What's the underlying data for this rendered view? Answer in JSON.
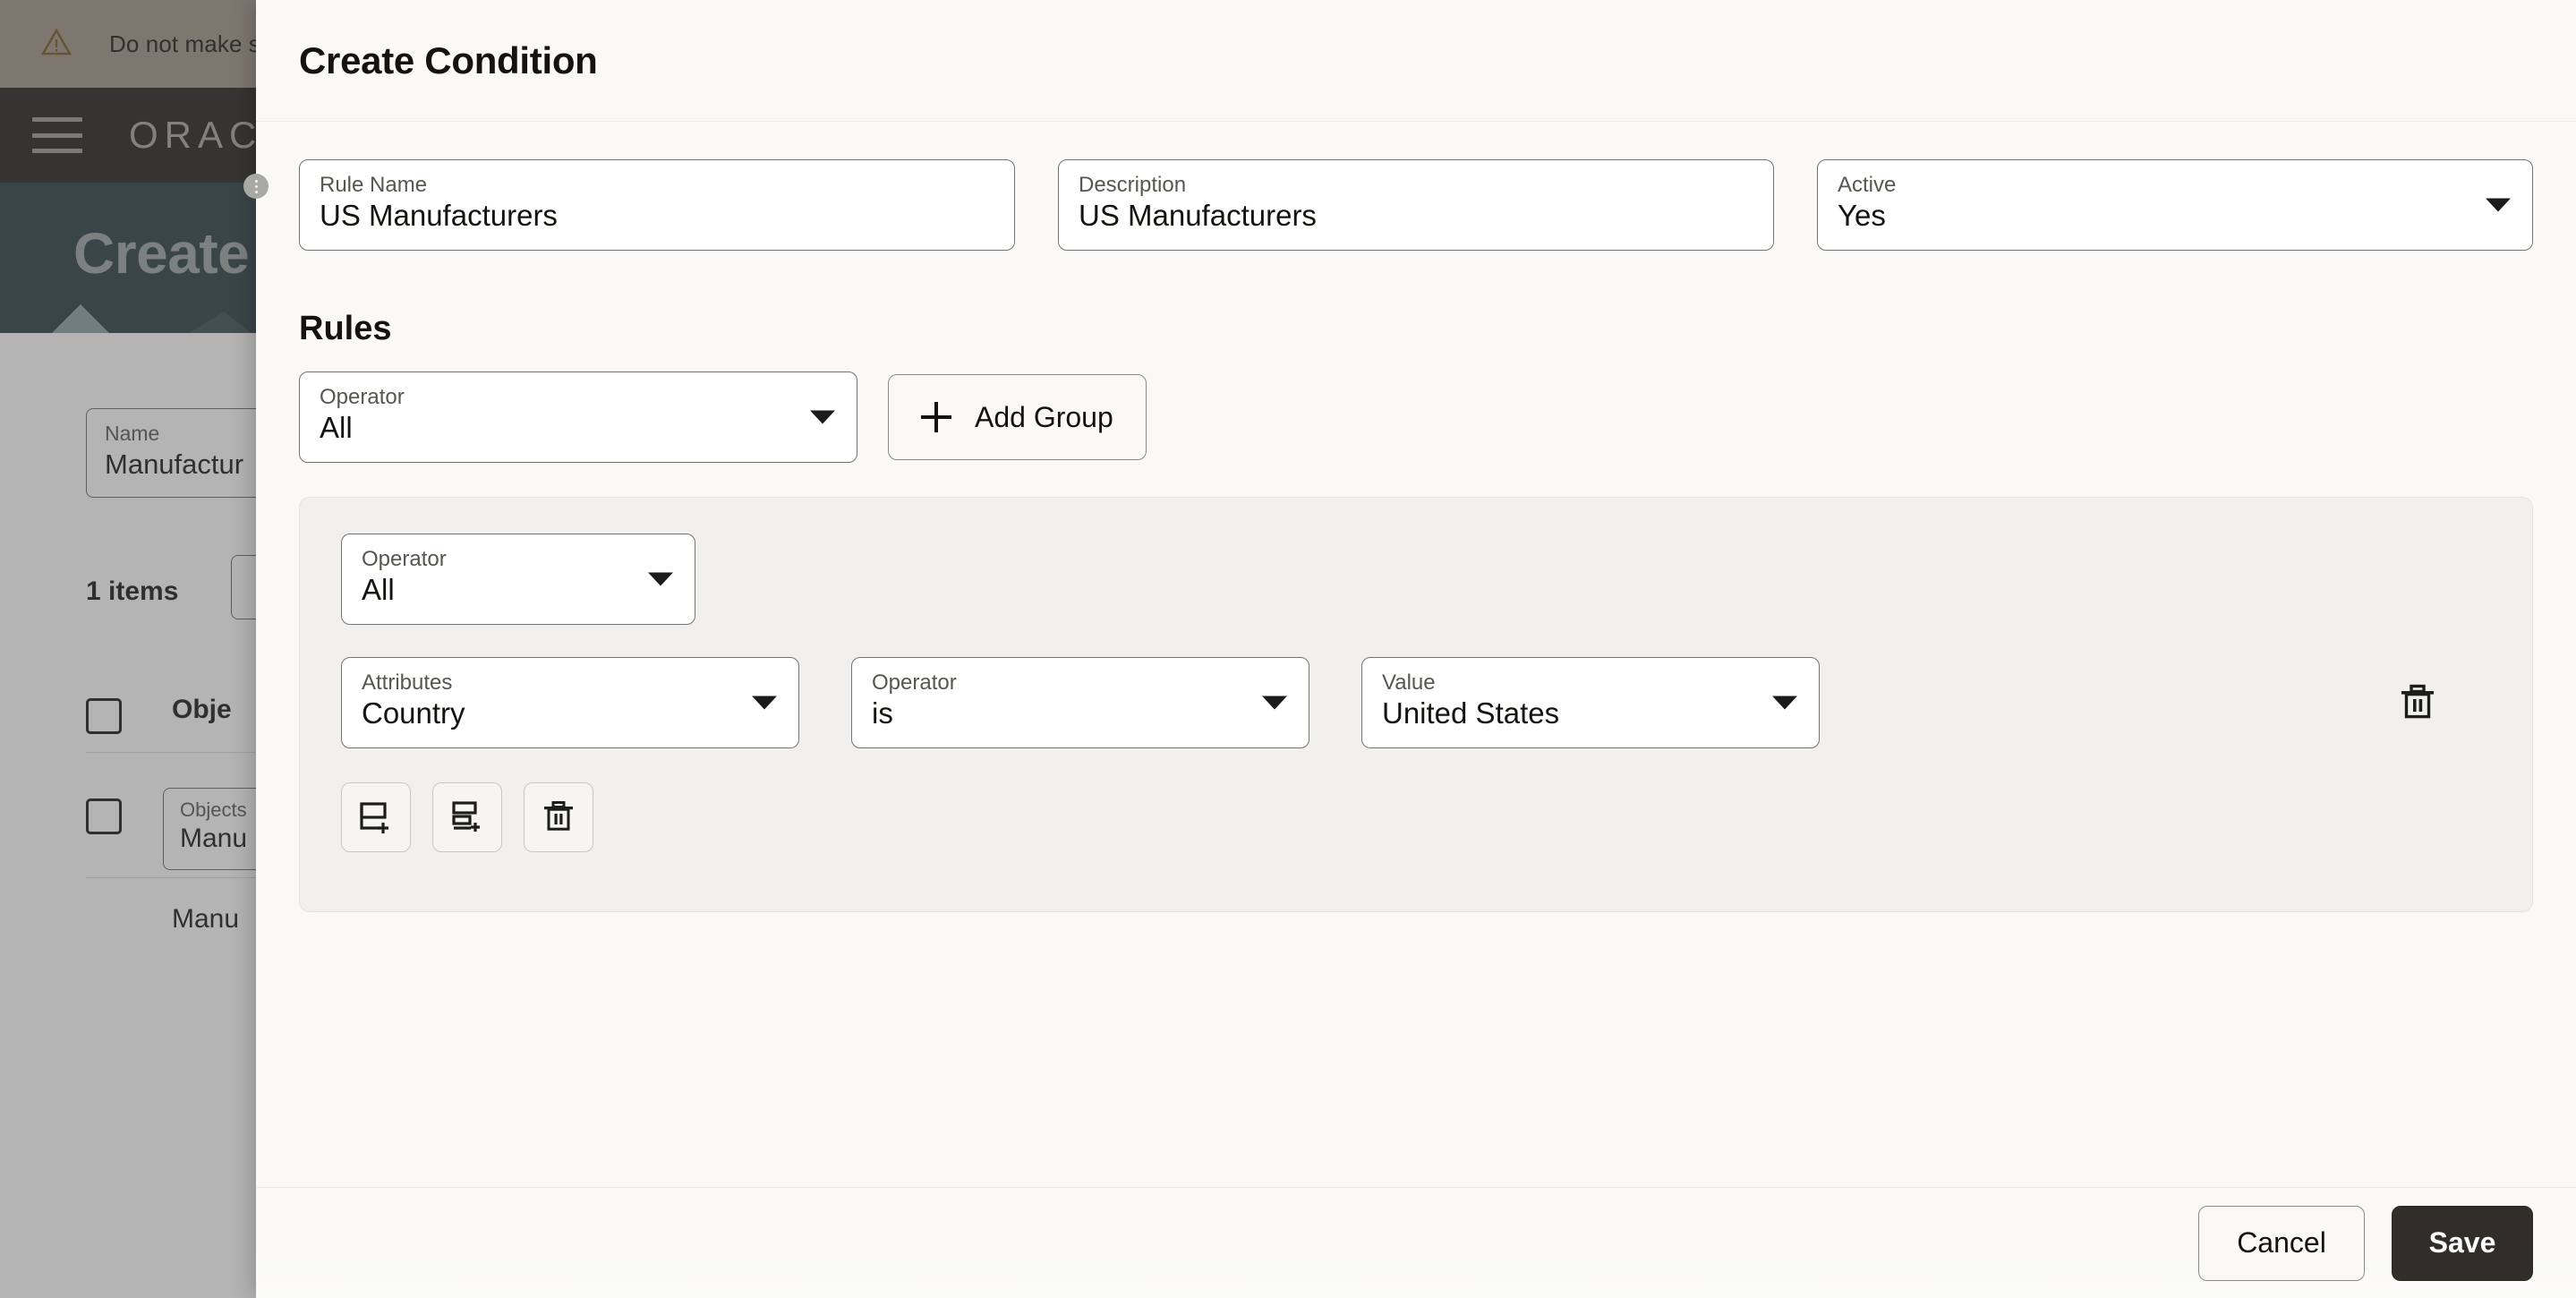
{
  "background": {
    "warning_banner": {
      "icon": "warning-triangle-icon",
      "text": "Do not make s",
      "bg_color": "#a3968a"
    },
    "topbar": {
      "menu_icon": "hamburger-menu-icon",
      "brand": "ORACLE",
      "bg_color": "#262421"
    },
    "hero": {
      "title": "Create",
      "bg_color": "#2d4044"
    },
    "name_field": {
      "label": "Name",
      "value": "Manufactur"
    },
    "items_count": "1 items",
    "table": {
      "columns": [
        "Obje"
      ],
      "rows": [
        {
          "cells": [
            "Manu"
          ]
        }
      ],
      "inline_editor": {
        "label": "Objects",
        "value": "Manu"
      }
    }
  },
  "dialog": {
    "title": "Create Condition",
    "fields": [
      {
        "label": "Rule Name",
        "value": "US Manufacturers",
        "type": "text"
      },
      {
        "label": "Description",
        "value": "US Manufacturers",
        "type": "text"
      },
      {
        "label": "Active",
        "value": "Yes",
        "type": "select"
      }
    ],
    "rules": {
      "section_title": "Rules",
      "operator": {
        "label": "Operator",
        "value": "All"
      },
      "add_group_button": {
        "label": "Add Group",
        "icon": "plus-icon"
      },
      "group": {
        "operator": {
          "label": "Operator",
          "value": "All"
        },
        "condition": {
          "attribute": {
            "label": "Attributes",
            "value": "Country"
          },
          "operator": {
            "label": "Operator",
            "value": "is"
          },
          "value": {
            "label": "Value",
            "value": "United States"
          },
          "delete_icon": "trash-icon"
        },
        "actions": [
          {
            "icon": "add-condition-icon"
          },
          {
            "icon": "add-group-nested-icon"
          },
          {
            "icon": "trash-icon"
          }
        ]
      }
    },
    "footer": {
      "cancel_label": "Cancel",
      "save_label": "Save"
    },
    "colors": {
      "surface": "#faf9f7",
      "group_surface": "#f1f0ee",
      "primary_button": "#312e29",
      "field_border": "#73726f",
      "text": "#15130f",
      "muted_text": "#57564f"
    }
  }
}
